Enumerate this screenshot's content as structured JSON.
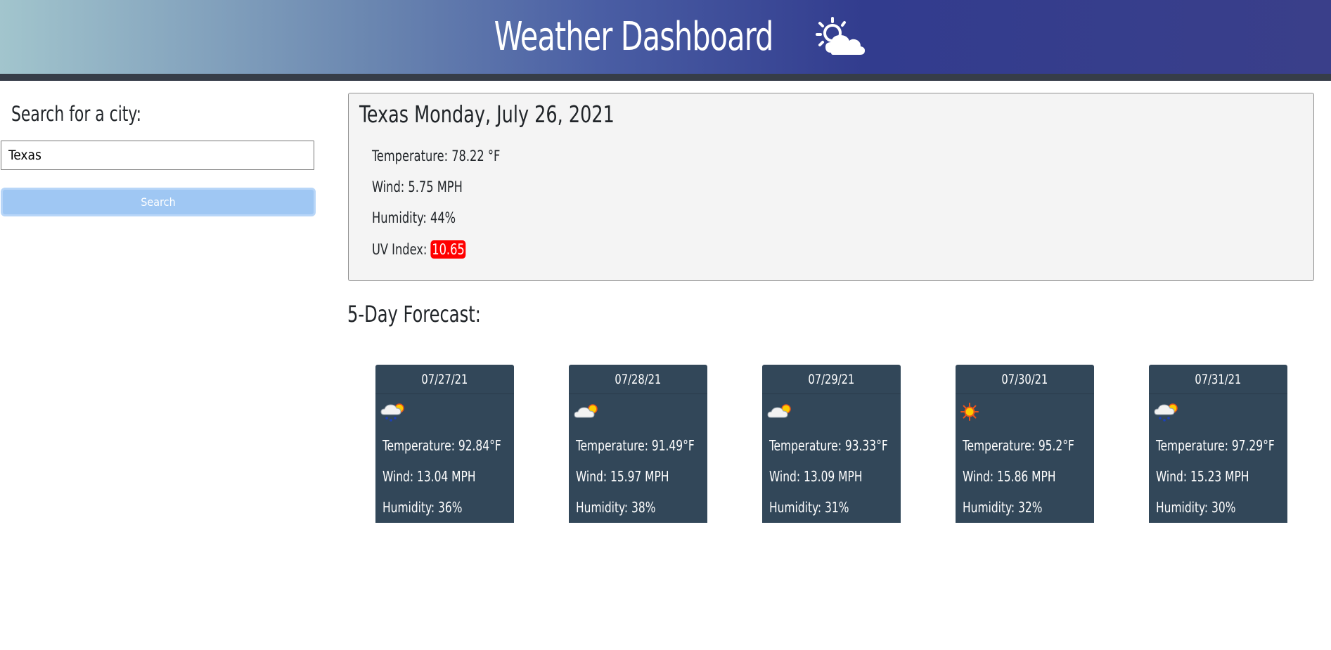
{
  "header": {
    "title": "Weather Dashboard",
    "icon": "sun-cloud-icon",
    "gradient": [
      "#a2c5cd",
      "#4a5ea4",
      "#323c8e",
      "#3a3f8a"
    ]
  },
  "sidebar": {
    "search_label": "Search for a city:",
    "search_value": "Texas",
    "search_button": "Search"
  },
  "current": {
    "title": "Texas Monday, July 26, 2021",
    "temperature": "Temperature: 78.22 °F",
    "wind": "Wind: 5.75 MPH",
    "humidity": "Humidity: 44%",
    "uv_label": "UV Index: ",
    "uv_value": "10.65",
    "uv_color": "#ff0000"
  },
  "forecast": {
    "heading": "5-Day Forecast:",
    "card_color": "#324759",
    "days": [
      {
        "date": "07/27/21",
        "icon": "rain-sun-icon",
        "temperature": "Temperature: 92.84°F",
        "wind": "Wind: 13.04 MPH",
        "humidity": "Humidity: 36%"
      },
      {
        "date": "07/28/21",
        "icon": "cloud-sun-icon",
        "temperature": "Temperature: 91.49°F",
        "wind": "Wind: 15.97 MPH",
        "humidity": "Humidity: 38%"
      },
      {
        "date": "07/29/21",
        "icon": "cloud-sun-icon",
        "temperature": "Temperature: 93.33°F",
        "wind": "Wind: 13.09 MPH",
        "humidity": "Humidity: 31%"
      },
      {
        "date": "07/30/21",
        "icon": "sun-icon",
        "temperature": "Temperature: 95.2°F",
        "wind": "Wind: 15.86 MPH",
        "humidity": "Humidity: 32%"
      },
      {
        "date": "07/31/21",
        "icon": "rain-sun-icon",
        "temperature": "Temperature: 97.29°F",
        "wind": "Wind: 15.23 MPH",
        "humidity": "Humidity: 30%"
      }
    ]
  }
}
